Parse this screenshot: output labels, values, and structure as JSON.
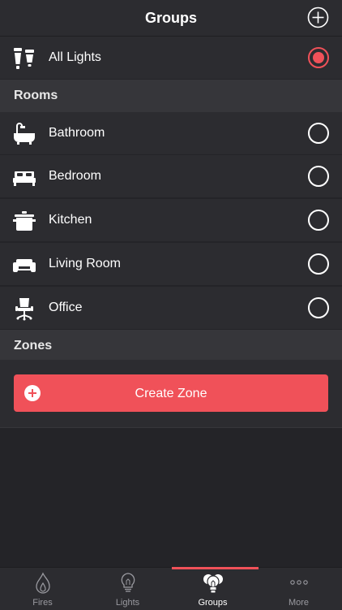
{
  "header": {
    "title": "Groups",
    "add_icon": "plus-circle-icon"
  },
  "all_lights": {
    "label": "All Lights",
    "icon": "lights-icon",
    "selected": true
  },
  "sections": {
    "rooms": "Rooms",
    "zones": "Zones"
  },
  "rooms": [
    {
      "label": "Bathroom",
      "icon": "bathtub-icon",
      "selected": false
    },
    {
      "label": "Bedroom",
      "icon": "bed-icon",
      "selected": false
    },
    {
      "label": "Kitchen",
      "icon": "pot-icon",
      "selected": false
    },
    {
      "label": "Living Room",
      "icon": "sofa-icon",
      "selected": false
    },
    {
      "label": "Office",
      "icon": "office-chair-icon",
      "selected": false
    }
  ],
  "zones": {
    "create_label": "Create Zone",
    "create_icon": "plus-circle-icon"
  },
  "tabs": [
    {
      "label": "Fires",
      "icon": "flame-icon",
      "active": false
    },
    {
      "label": "Lights",
      "icon": "bulb-icon",
      "active": false
    },
    {
      "label": "Groups",
      "icon": "bulbs-group-icon",
      "active": true
    },
    {
      "label": "More",
      "icon": "more-dots-icon",
      "active": false
    }
  ],
  "colors": {
    "accent": "#f05159",
    "background": "#242428",
    "row": "#2c2c30",
    "section": "#36363a"
  }
}
